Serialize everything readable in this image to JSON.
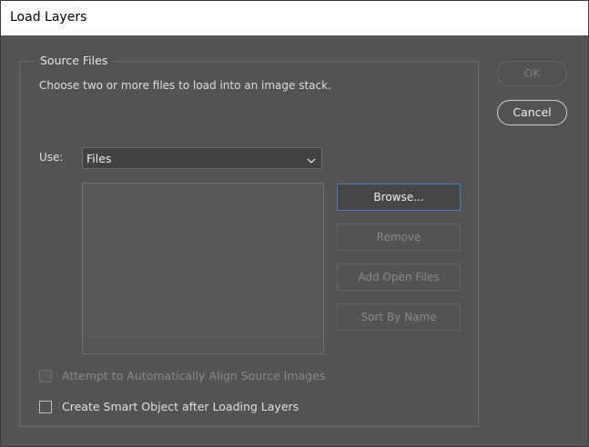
{
  "window": {
    "title": "Load Layers"
  },
  "source_files": {
    "legend": "Source Files",
    "description": "Choose two or more files to load into an image stack.",
    "use_label": "Use:",
    "use_select": {
      "selected": "Files",
      "icon": "chevron-down-icon"
    },
    "file_list": [],
    "buttons": {
      "browse": "Browse...",
      "remove": "Remove",
      "add_open_files": "Add Open Files",
      "sort_by_name": "Sort By Name"
    }
  },
  "options": {
    "align_images": {
      "label": "Attempt to Automatically Align Source Images",
      "checked": false,
      "enabled": false
    },
    "smart_object": {
      "label": "Create Smart Object after Loading Layers",
      "checked": false,
      "enabled": true
    }
  },
  "dialog_buttons": {
    "ok": "OK",
    "cancel": "Cancel"
  },
  "colors": {
    "background": "#535353",
    "accent_focus": "#4d7bc2"
  }
}
